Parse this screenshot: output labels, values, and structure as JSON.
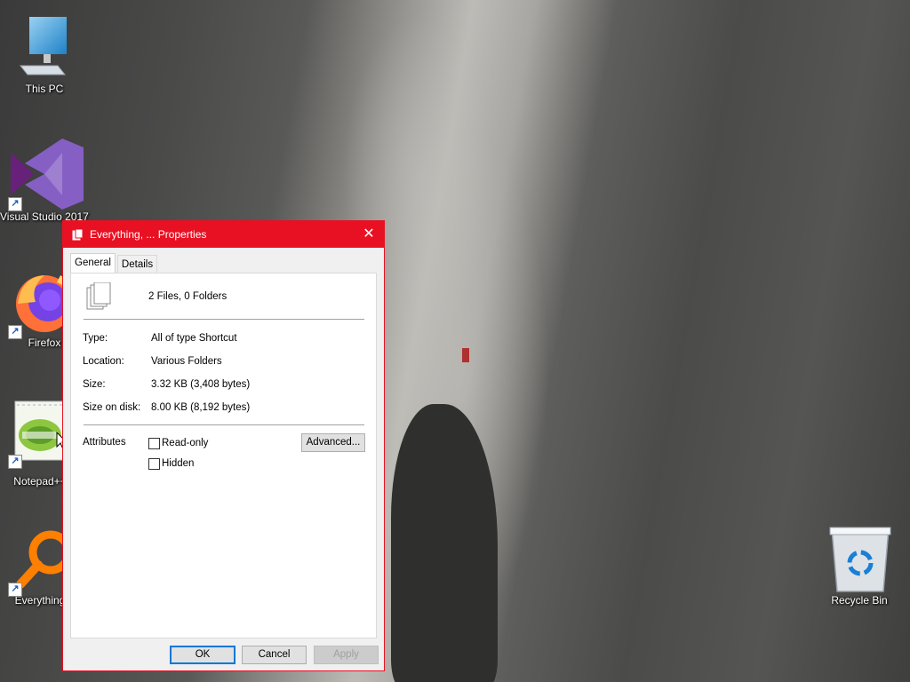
{
  "desktop": {
    "icons": [
      {
        "label": "This PC"
      },
      {
        "label": "Visual Studio 2017"
      },
      {
        "label": "Firefox"
      },
      {
        "label": "Notepad++"
      },
      {
        "label": "Everything"
      },
      {
        "label": "Recycle Bin"
      }
    ]
  },
  "dialog": {
    "title": "Everything, ... Properties",
    "close_glyph": "✕",
    "tabs": [
      {
        "label": "General",
        "active": true
      },
      {
        "label": "Details",
        "active": false
      }
    ],
    "summary": "2 Files, 0 Folders",
    "props": [
      {
        "label": "Type:",
        "value": "All of type Shortcut"
      },
      {
        "label": "Location:",
        "value": "Various Folders"
      },
      {
        "label": "Size:",
        "value": "3.32 KB (3,408 bytes)"
      },
      {
        "label": "Size on disk:",
        "value": "8.00 KB (8,192 bytes)"
      }
    ],
    "attributes_label": "Attributes",
    "readonly_label": "Read-only",
    "readonly_checked": false,
    "hidden_label": "Hidden",
    "hidden_checked": false,
    "advanced_label": "Advanced...",
    "ok_label": "OK",
    "cancel_label": "Cancel",
    "apply_label": "Apply"
  },
  "colors": {
    "titlebar": "#e81123",
    "default_button_border": "#0078d7"
  }
}
